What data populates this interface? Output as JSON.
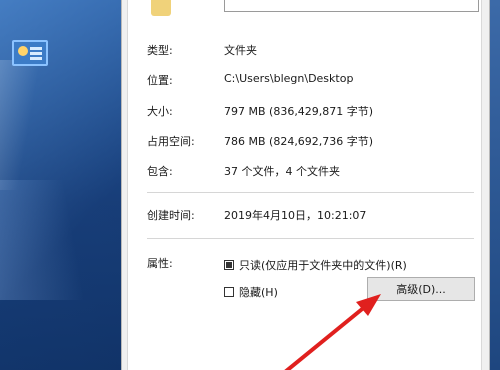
{
  "dialog": {
    "properties": [
      {
        "label": "类型:",
        "value": "文件夹"
      },
      {
        "label": "位置:",
        "value": "C:\\Users\\blegn\\Desktop"
      },
      {
        "label": "大小:",
        "value": "797 MB (836,429,871 字节)"
      },
      {
        "label": "占用空间:",
        "value": "786 MB (824,692,736 字节)"
      },
      {
        "label": "包含:",
        "value": "37 个文件，4 个文件夹"
      }
    ],
    "created": {
      "label": "创建时间:",
      "value": "2019年4月10日，10:21:07"
    },
    "attributes": {
      "label": "属性:",
      "readonly_label": "只读(仅应用于文件夹中的文件)(R)",
      "readonly_checked": true,
      "hidden_label": "隐藏(H)",
      "hidden_checked": false,
      "advanced_button": "高级(D)..."
    }
  },
  "annotation": {
    "color": "#e0201e"
  }
}
